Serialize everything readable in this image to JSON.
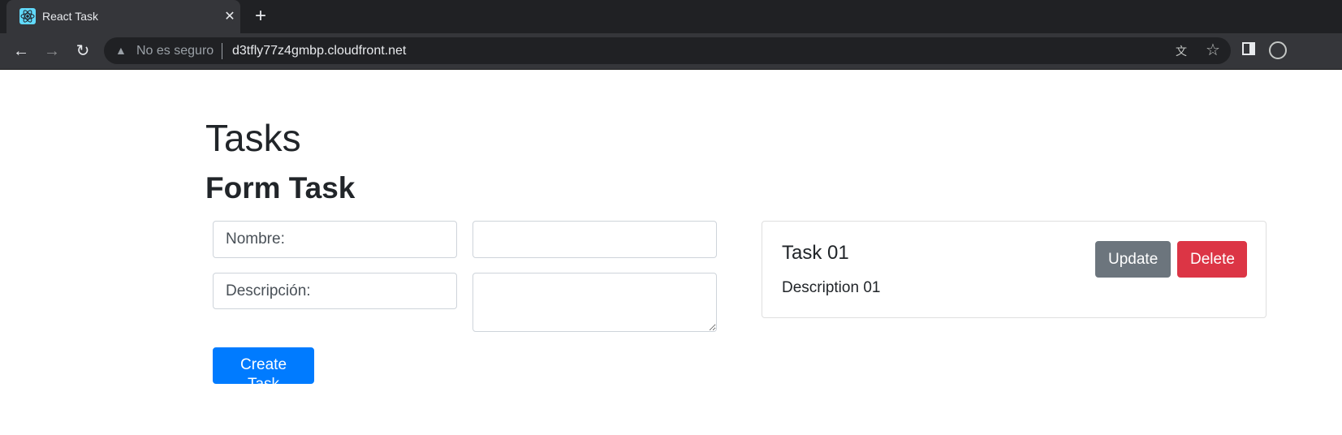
{
  "browser": {
    "tab": {
      "title": "React Task",
      "icon": "react-logo-icon"
    },
    "address": {
      "security_text": "No es seguro",
      "url": "d3tfly77z4gmbp.cloudfront.net"
    }
  },
  "page": {
    "title": "Tasks",
    "form": {
      "heading": "Form Task",
      "name_label": "Nombre:",
      "name_value": "",
      "description_label": "Descripción:",
      "description_value": "",
      "submit_label": "Create Task"
    },
    "tasks": [
      {
        "title": "Task 01",
        "description": "Description 01",
        "update_label": "Update",
        "delete_label": "Delete"
      }
    ]
  },
  "colors": {
    "primary": "#007bff",
    "secondary": "#6c757d",
    "danger": "#dc3545",
    "text": "#212529"
  }
}
